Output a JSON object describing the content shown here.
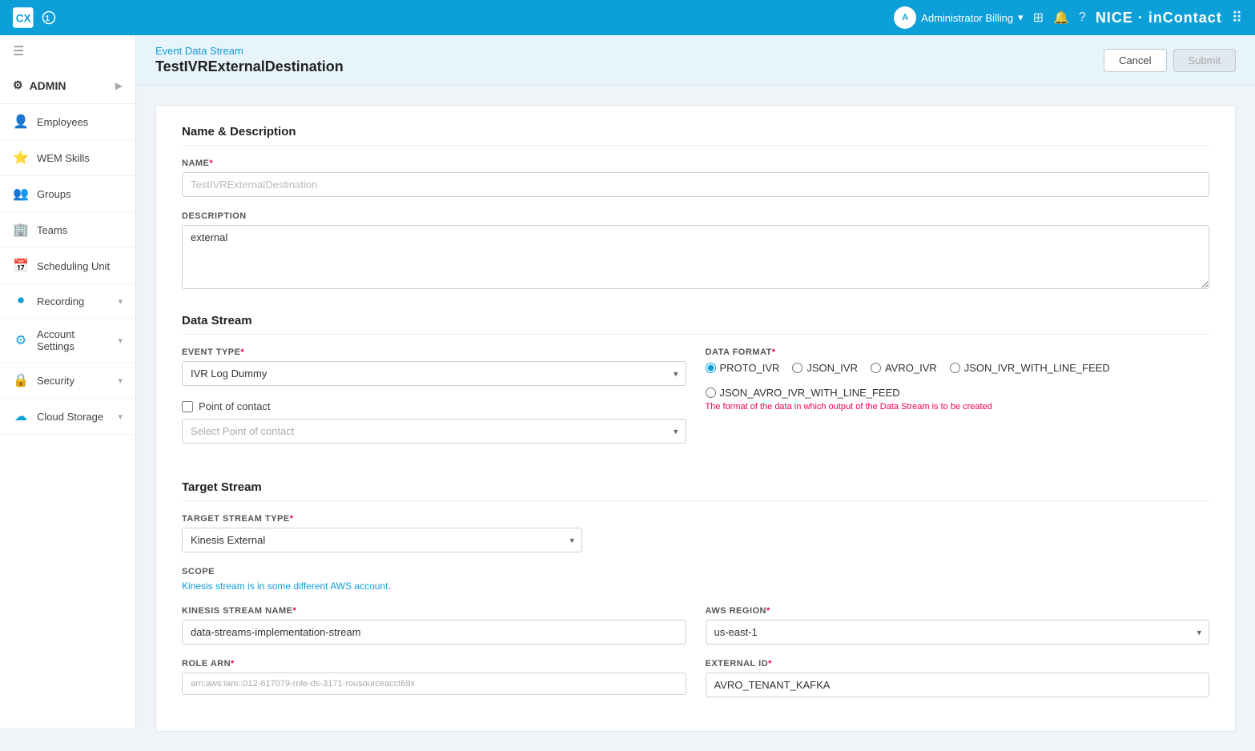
{
  "topNav": {
    "user": "Administrator Billing",
    "niceBrand": "NICE · inContact"
  },
  "sidebar": {
    "admin": "ADMIN",
    "items": [
      {
        "id": "employees",
        "label": "Employees",
        "icon": "👤"
      },
      {
        "id": "wem-skills",
        "label": "WEM Skills",
        "icon": "⭐"
      },
      {
        "id": "groups",
        "label": "Groups",
        "icon": "👥"
      },
      {
        "id": "teams",
        "label": "Teams",
        "icon": "🏢"
      },
      {
        "id": "scheduling-unit",
        "label": "Scheduling Unit",
        "icon": "📅"
      },
      {
        "id": "recording",
        "label": "Recording",
        "icon": "⏺",
        "hasArrow": true
      },
      {
        "id": "account-settings",
        "label": "Account Settings",
        "icon": "⚙",
        "hasArrow": true
      },
      {
        "id": "security",
        "label": "Security",
        "icon": "🔒",
        "hasArrow": true
      },
      {
        "id": "cloud-storage",
        "label": "Cloud Storage",
        "icon": "☁",
        "hasArrow": true
      }
    ]
  },
  "header": {
    "breadcrumb": "Event Data Stream",
    "title": "TestIVRExternalDestination",
    "cancelLabel": "Cancel",
    "submitLabel": "Submit"
  },
  "form": {
    "sections": {
      "nameDesc": {
        "title": "Name & Description",
        "nameLabel": "NAME",
        "nameValue": "TestIVRExternalDestination",
        "descLabel": "DESCRIPTION",
        "descValue": "external"
      },
      "dataStream": {
        "title": "Data Stream",
        "eventTypeLabel": "EVENT TYPE",
        "eventTypeValue": "IVR Log Dummy",
        "dataFormatLabel": "DATA FORMAT",
        "dataFormatHint": "The format of the data in which output of the Data Stream is to be created",
        "dataFormatOptions": [
          {
            "value": "PROTO_IVR",
            "label": "PROTO_IVR",
            "selected": true
          },
          {
            "value": "JSON_IVR",
            "label": "JSON_IVR",
            "selected": false
          },
          {
            "value": "AVRO_IVR",
            "label": "AVRO_IVR",
            "selected": false
          },
          {
            "value": "JSON_IVR_WITH_LINE_FEED",
            "label": "JSON_IVR_WITH_LINE_FEED",
            "selected": false
          },
          {
            "value": "JSON_AVRO_IVR_WITH_LINE_FEED",
            "label": "JSON_AVRO_IVR_WITH_LINE_FEED",
            "selected": false
          }
        ],
        "pointOfContactLabel": "Point of contact",
        "pointOfContactPlaceholder": "Select Point of contact"
      },
      "targetStream": {
        "title": "Target Stream",
        "targetStreamTypeLabel": "TARGET STREAM TYPE",
        "targetStreamTypeValue": "Kinesis External",
        "scopeLabel": "SCOPE",
        "scopeText": "Kinesis stream is in some different AWS account.",
        "kinesisStreamNameLabel": "KINESIS STREAM NAME",
        "kinesisStreamNameValue": "data-streams-implementation-stream",
        "awsRegionLabel": "AWS REGION",
        "awsRegionValue": "us-east-1",
        "roleArnLabel": "ROLE ARN",
        "roleArnValue": "arn:aws:iam::012-617079-role-ds-3171-rousourceacct69x",
        "externalIdLabel": "EXTERNAL ID",
        "externalIdValue": "AVRO_TENANT_KAFKA"
      }
    }
  }
}
